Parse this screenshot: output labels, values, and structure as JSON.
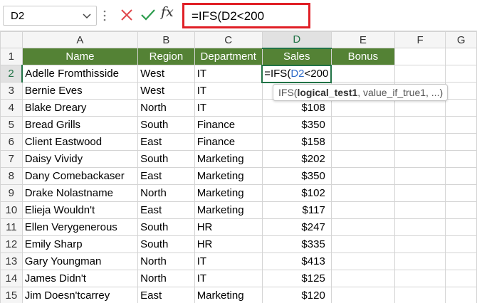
{
  "formula_bar": {
    "name_box": "D2",
    "formula": "=IFS(D2<200",
    "icons": [
      "chevron-down-icon",
      "more-dots-icon",
      "cancel-icon",
      "enter-check-icon",
      "insert-function-icon"
    ]
  },
  "function_icon_label": "fx",
  "columns": [
    "A",
    "B",
    "C",
    "D",
    "E",
    "F",
    "G"
  ],
  "headers": {
    "name": "Name",
    "region": "Region",
    "department": "Department",
    "sales": "Sales",
    "bonus": "Bonus"
  },
  "editing_cell": {
    "prefix": "=IFS(",
    "ref": "D2",
    "suffix": "<200"
  },
  "tooltip": {
    "func": "IFS(",
    "arg1": "logical_test1",
    "rest": ", value_if_true1, ...)"
  },
  "rows": [
    {
      "row": "2",
      "name": "Adelle Fromthisside",
      "region": "West",
      "department": "IT",
      "sales": ""
    },
    {
      "row": "3",
      "name": "Bernie Eves",
      "region": "West",
      "department": "IT",
      "sales": ""
    },
    {
      "row": "4",
      "name": "Blake Dreary",
      "region": "North",
      "department": "IT",
      "sales": "$108"
    },
    {
      "row": "5",
      "name": "Bread Grills",
      "region": "South",
      "department": "Finance",
      "sales": "$350"
    },
    {
      "row": "6",
      "name": "Client Eastwood",
      "region": "East",
      "department": "Finance",
      "sales": "$158"
    },
    {
      "row": "7",
      "name": "Daisy Vividy",
      "region": "South",
      "department": "Marketing",
      "sales": "$202"
    },
    {
      "row": "8",
      "name": "Dany Comebackaser",
      "region": "East",
      "department": "Marketing",
      "sales": "$350"
    },
    {
      "row": "9",
      "name": "Drake Nolastname",
      "region": "North",
      "department": "Marketing",
      "sales": "$102"
    },
    {
      "row": "10",
      "name": "Elieja Wouldn't",
      "region": "East",
      "department": "Marketing",
      "sales": "$117"
    },
    {
      "row": "11",
      "name": "Ellen Verygenerous",
      "region": "South",
      "department": "HR",
      "sales": "$247"
    },
    {
      "row": "12",
      "name": "Emily Sharp",
      "region": "South",
      "department": "HR",
      "sales": "$335"
    },
    {
      "row": "13",
      "name": "Gary Youngman",
      "region": "North",
      "department": "IT",
      "sales": "$413"
    },
    {
      "row": "14",
      "name": "James Didn't",
      "region": "North",
      "department": "IT",
      "sales": "$125"
    },
    {
      "row": "15",
      "name": "Jim Doesn'tcarrey",
      "region": "East",
      "department": "Marketing",
      "sales": "$120"
    }
  ],
  "colors": {
    "header_fill": "#548235",
    "selection_green": "#217346",
    "highlight_red": "#e01f26",
    "cell_ref_blue": "#2f6bc8"
  }
}
